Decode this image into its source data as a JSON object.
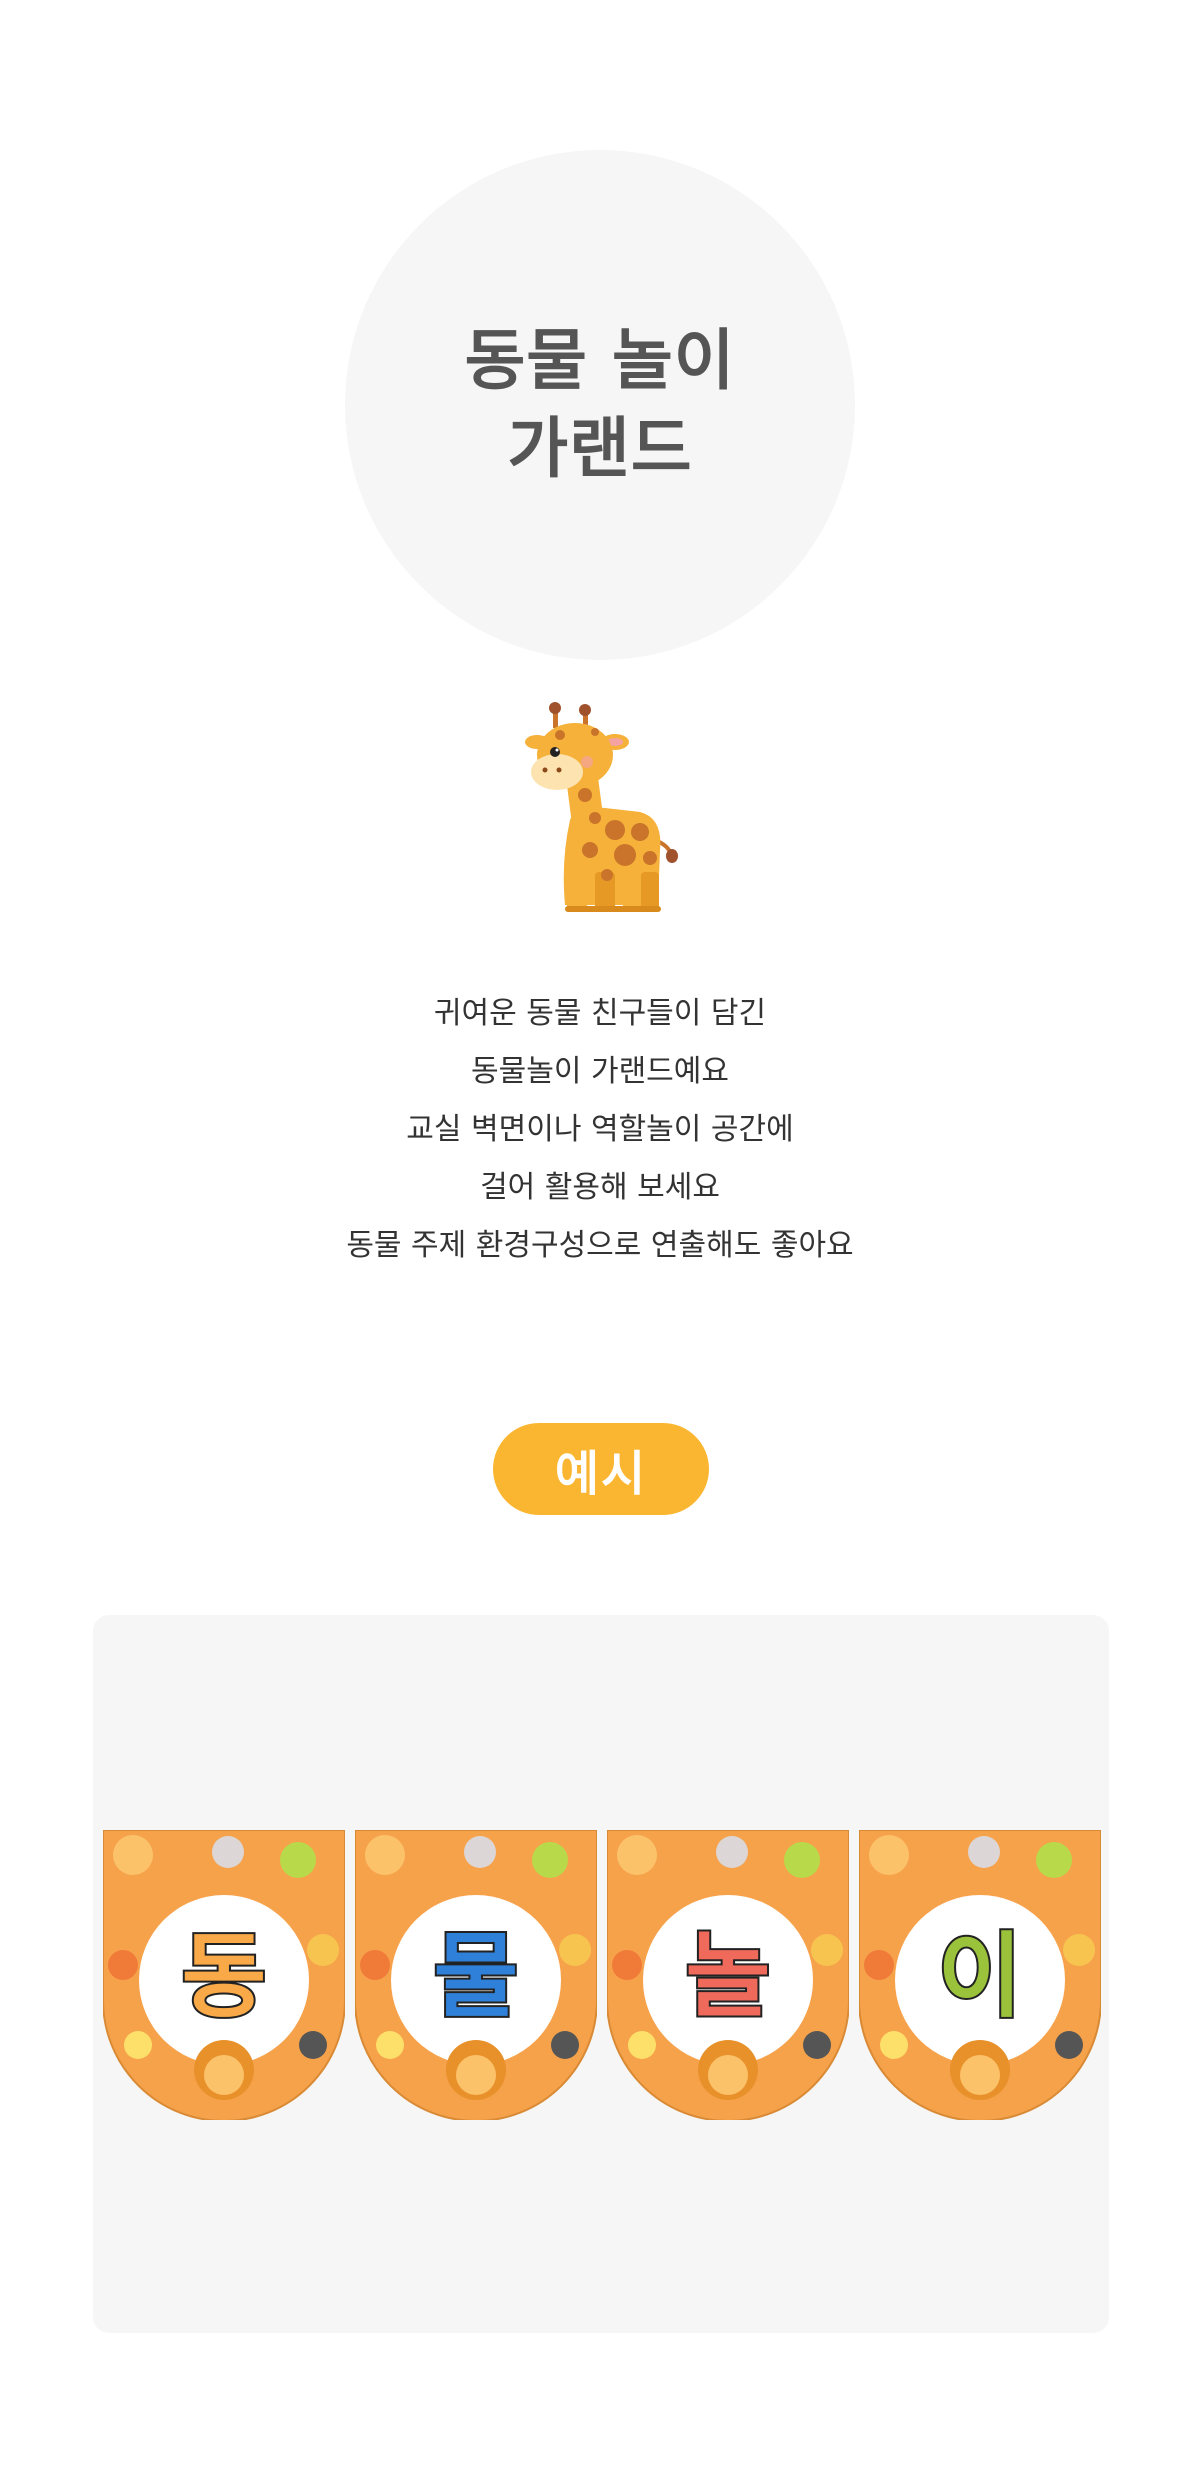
{
  "hero": {
    "title_line1": "동물 놀이",
    "title_line2": "가랜드"
  },
  "mascot_icon": "giraffe-icon",
  "description": {
    "lines": [
      "귀여운 동물 친구들이 담긴",
      "동물놀이 가랜드예요",
      "교실 벽면이나 역할놀이 공간에",
      "걸어 활용해 보세요",
      "동물 주제 환경구성으로 연출해도 좋아요"
    ]
  },
  "example": {
    "badge_label": "예시"
  },
  "garland": {
    "pennants": [
      {
        "char": "동",
        "color": "#f9a948"
      },
      {
        "char": "물",
        "color": "#2f80d8"
      },
      {
        "char": "놀",
        "color": "#f06a5c"
      },
      {
        "char": "이",
        "color": "#9ac23b"
      }
    ]
  },
  "colors": {
    "accent": "#fbb631",
    "pennant_bg": "#f6a24b",
    "panel_bg": "#f6f6f6"
  }
}
